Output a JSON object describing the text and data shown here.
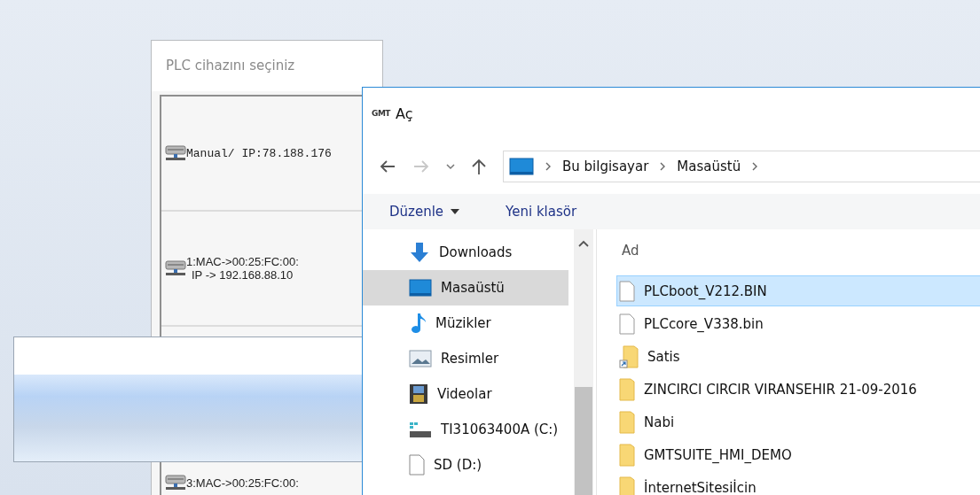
{
  "plc_window": {
    "title": "PLC cihazını seçiniz",
    "devices": [
      {
        "lines": [
          "Manual/ IP:78.188.176"
        ],
        "kind": "mono"
      },
      {
        "lines": [
          "1:MAC->00:25:FC:00:",
          "IP  -> 192.168.88.10"
        ],
        "kind": "sans"
      },
      {
        "lines": [
          "3:MAC->00:25:FC:00:"
        ],
        "kind": "sans"
      }
    ]
  },
  "open_dialog": {
    "logo": "GMT",
    "title": "Aç",
    "breadcrumb": [
      "Bu bilgisayar",
      "Masaüstü"
    ],
    "commands": [
      {
        "label": "Düzenle",
        "kind": "menu"
      },
      {
        "label": "Yeni klasör",
        "kind": "plain"
      }
    ],
    "nav_items": [
      {
        "label": "Downloads",
        "kind": "download",
        "selected": false
      },
      {
        "label": "Masaüstü",
        "kind": "desktop",
        "selected": true
      },
      {
        "label": "Müzikler",
        "kind": "music",
        "selected": false
      },
      {
        "label": "Resimler",
        "kind": "pictures",
        "selected": false
      },
      {
        "label": "Videolar",
        "kind": "videos",
        "selected": false
      },
      {
        "label": "TI31063400A (C:)",
        "kind": "drive",
        "selected": false
      },
      {
        "label": "SD (D:)",
        "kind": "file",
        "selected": false
      }
    ],
    "column_header": "Ad",
    "files": [
      {
        "name": "PLCboot_V212.BIN",
        "kind": "file",
        "selected": true
      },
      {
        "name": "PLCcore_V338.bin",
        "kind": "file",
        "selected": false
      },
      {
        "name": "Satis",
        "kind": "shortcut",
        "selected": false
      },
      {
        "name": "ZINCIRCI CIRCIR VIRANSEHIR 21-09-2016",
        "kind": "folder",
        "selected": false
      },
      {
        "name": "Nabi",
        "kind": "folder",
        "selected": false
      },
      {
        "name": "GMTSUITE_HMI_DEMO",
        "kind": "folder",
        "selected": false
      },
      {
        "name": "İnternetSitesiİcin",
        "kind": "folder",
        "selected": false
      }
    ]
  }
}
